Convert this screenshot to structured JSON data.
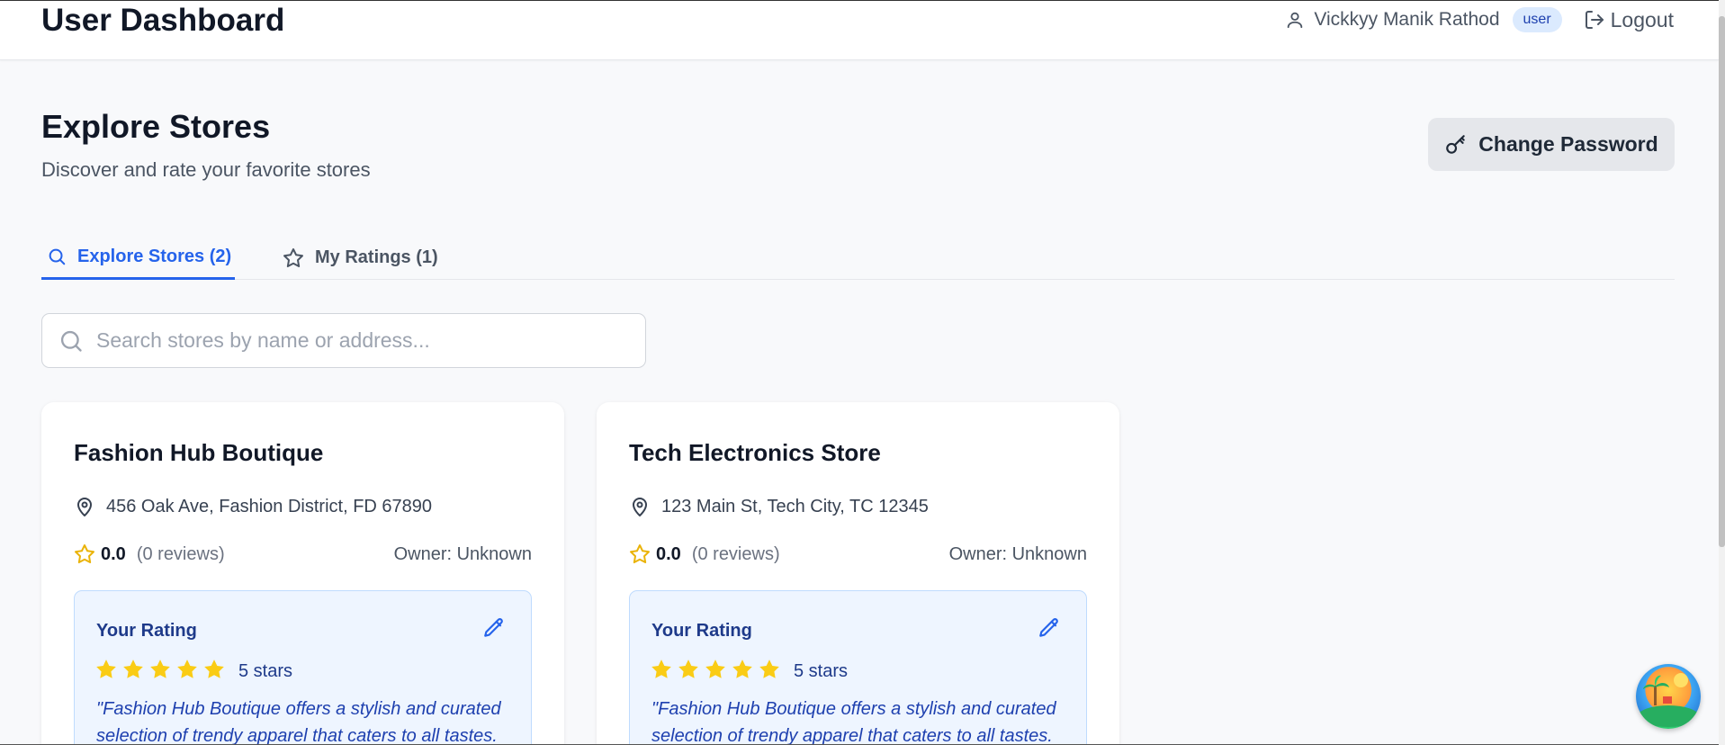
{
  "header": {
    "title": "User Dashboard",
    "user_name": "Vickkyy Manik Rathod",
    "role": "user",
    "logout_label": "Logout"
  },
  "page": {
    "title": "Explore Stores",
    "subtitle": "Discover and rate your favorite stores",
    "change_password_label": "Change Password"
  },
  "tabs": [
    {
      "label": "Explore Stores (2)",
      "active": true
    },
    {
      "label": "My Ratings (1)",
      "active": false
    }
  ],
  "search": {
    "placeholder": "Search stores by name or address...",
    "value": ""
  },
  "stores": [
    {
      "name": "Fashion Hub Boutique",
      "address": "456 Oak Ave, Fashion District, FD 67890",
      "avg_rating": "0.0",
      "reviews": "(0 reviews)",
      "owner": "Owner: Unknown",
      "your_rating_label": "Your Rating",
      "user_rating": 5,
      "user_rating_text": "5 stars",
      "review": "\"Fashion Hub Boutique offers a stylish and curated selection of trendy apparel that caters to all tastes."
    },
    {
      "name": "Tech Electronics Store",
      "address": "123 Main St, Tech City, TC 12345",
      "avg_rating": "0.0",
      "reviews": "(0 reviews)",
      "owner": "Owner: Unknown",
      "your_rating_label": "Your Rating",
      "user_rating": 5,
      "user_rating_text": "5 stars",
      "review": "\"Fashion Hub Boutique offers a stylish and curated selection of trendy apparel that caters to all tastes."
    }
  ],
  "colors": {
    "accent": "#2563eb",
    "star": "#facc15",
    "rating_box_bg": "#eef5ff",
    "rating_text": "#1e3a8a"
  },
  "icons": {
    "user": "user-icon",
    "logout": "logout-icon",
    "key": "key-icon",
    "search": "search-icon",
    "star": "star-icon",
    "map_pin": "map-pin-icon",
    "edit": "pencil-icon"
  }
}
